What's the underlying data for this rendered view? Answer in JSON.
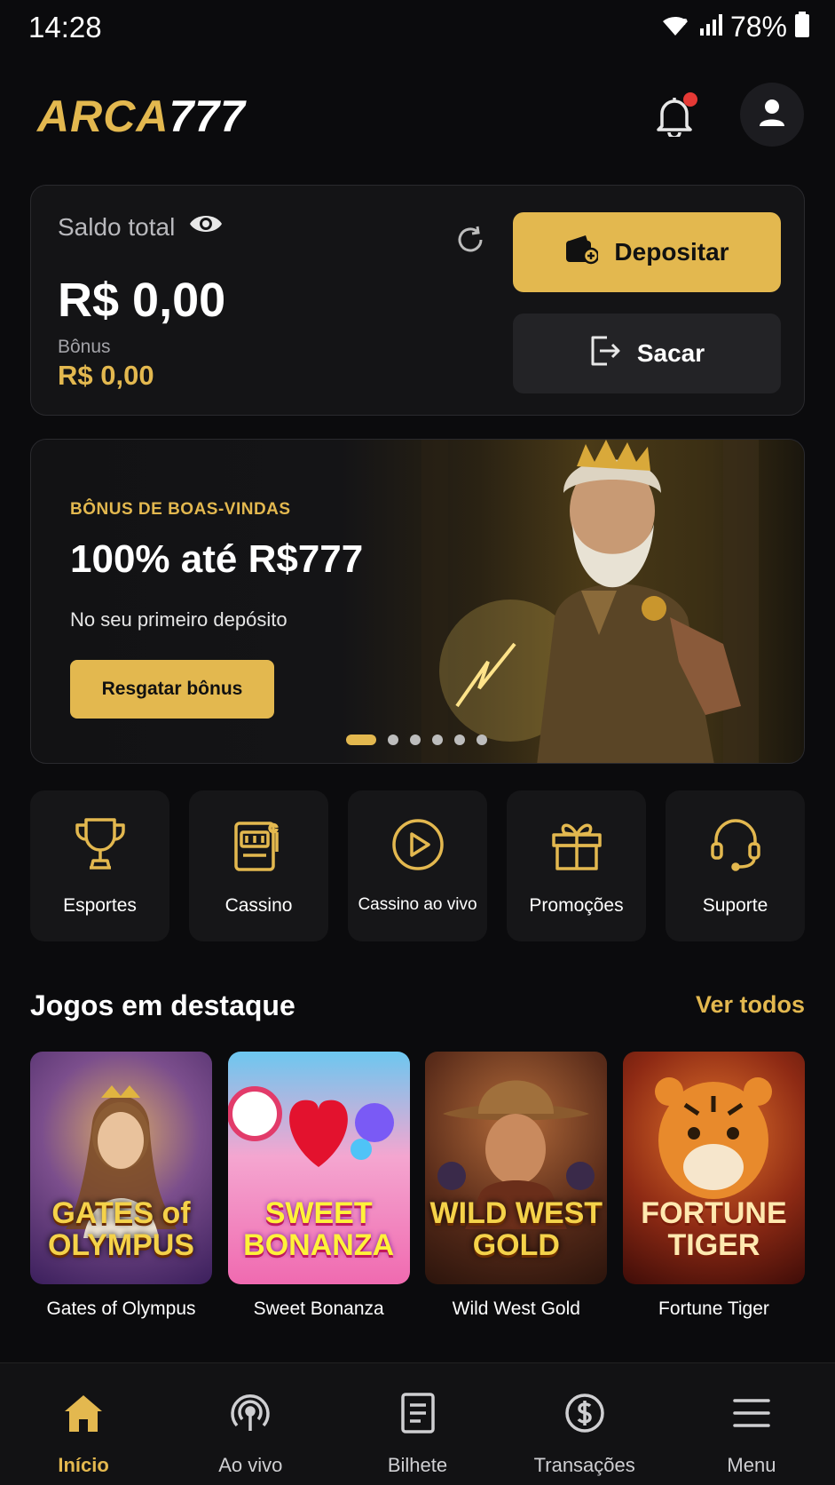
{
  "status_bar": {
    "time": "14:28",
    "battery": "78%"
  },
  "header": {
    "logo_part1": "ARCA",
    "logo_part2": "777"
  },
  "balance": {
    "label": "Saldo total",
    "value": "R$ 0,00",
    "bonus_label": "Bônus",
    "bonus_value": "R$ 0,00",
    "deposit_label": "Depositar",
    "withdraw_label": "Sacar"
  },
  "promo": {
    "kicker": "BÔNUS DE BOAS-VINDAS",
    "title": "100% até R$777",
    "subtitle": "No seu primeiro depósito",
    "button": "Resgatar bônus",
    "slide_count": 6,
    "active_slide": 1
  },
  "quick_nav": [
    {
      "label": "Esportes",
      "icon": "trophy-icon"
    },
    {
      "label": "Cassino",
      "icon": "slot-machine-icon"
    },
    {
      "label": "Cassino ao vivo",
      "icon": "play-circle-icon"
    },
    {
      "label": "Promoções",
      "icon": "gift-icon"
    },
    {
      "label": "Suporte",
      "icon": "headset-icon"
    }
  ],
  "featured": {
    "title": "Jogos em destaque",
    "see_all": "Ver todos",
    "games": [
      {
        "name": "Gates of Olympus",
        "art_text": "GATES of OLYMPUS"
      },
      {
        "name": "Sweet Bonanza",
        "art_text": "SWEET BONANZA"
      },
      {
        "name": "Wild West Gold",
        "art_text": "WILD WEST GOLD"
      },
      {
        "name": "Fortune Tiger",
        "art_text": "FORTUNE TIGER"
      }
    ]
  },
  "bottom_nav": [
    {
      "label": "Início",
      "icon": "home-icon",
      "active": true
    },
    {
      "label": "Ao vivo",
      "icon": "live-broadcast-icon",
      "active": false
    },
    {
      "label": "Bilhete",
      "icon": "ticket-icon",
      "active": false
    },
    {
      "label": "Transações",
      "icon": "dollar-circle-icon",
      "active": false
    },
    {
      "label": "Menu",
      "icon": "hamburger-menu-icon",
      "active": false
    }
  ],
  "colors": {
    "accent": "#e3b84f",
    "background": "#0b0b0d",
    "card": "#141416",
    "notification": "#e53935"
  }
}
